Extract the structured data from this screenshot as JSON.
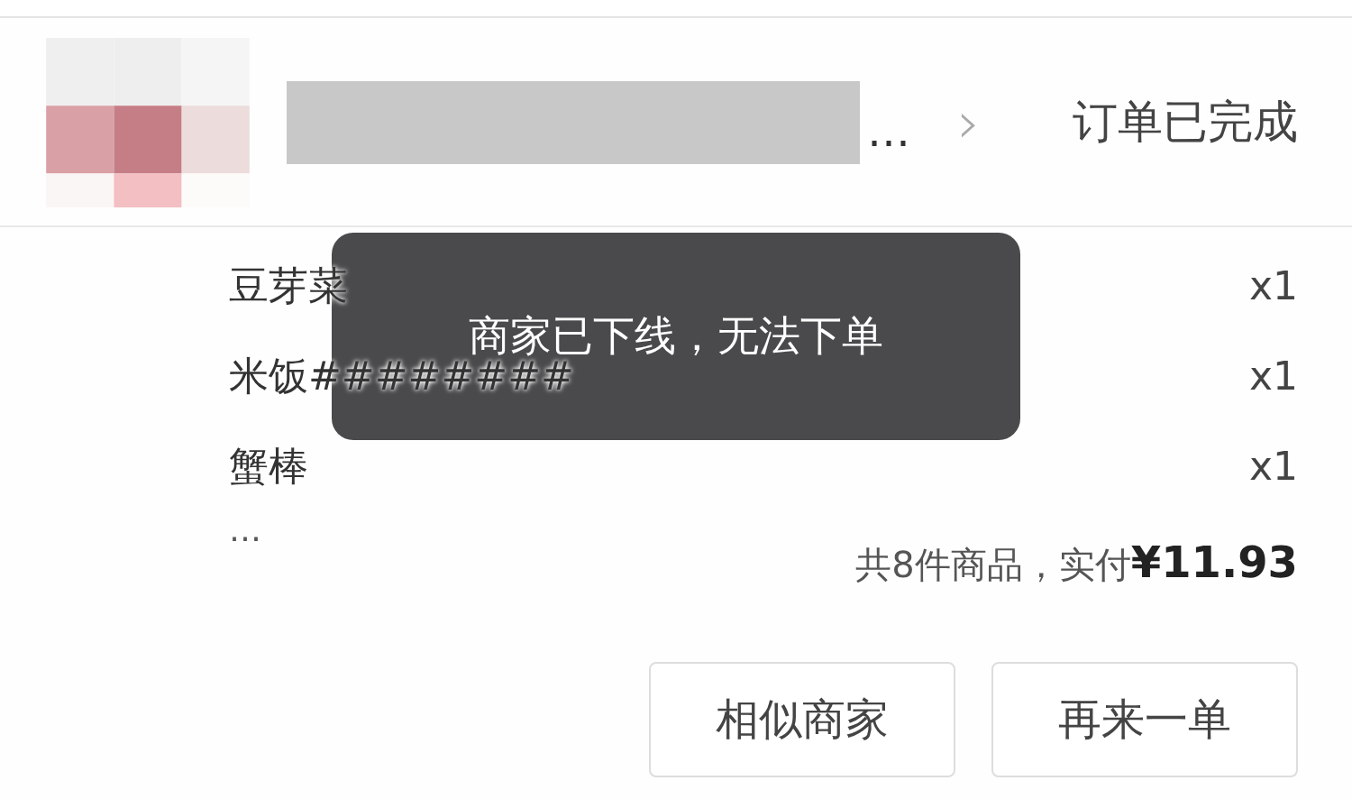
{
  "order": {
    "shop_name_ellipsis": "…",
    "chevron": "›",
    "status": "订单已完成"
  },
  "items": [
    {
      "name": "豆芽菜",
      "qty": "x1"
    },
    {
      "name": "米饭########",
      "qty": "x1"
    },
    {
      "name": "蟹棒",
      "qty": "x1"
    }
  ],
  "more": "…",
  "total": "共8件商品，实付**¥11.93**",
  "buttons": [
    "相似商家",
    "再来一单"
  ],
  "toast": "商家已下线，无法下单"
}
